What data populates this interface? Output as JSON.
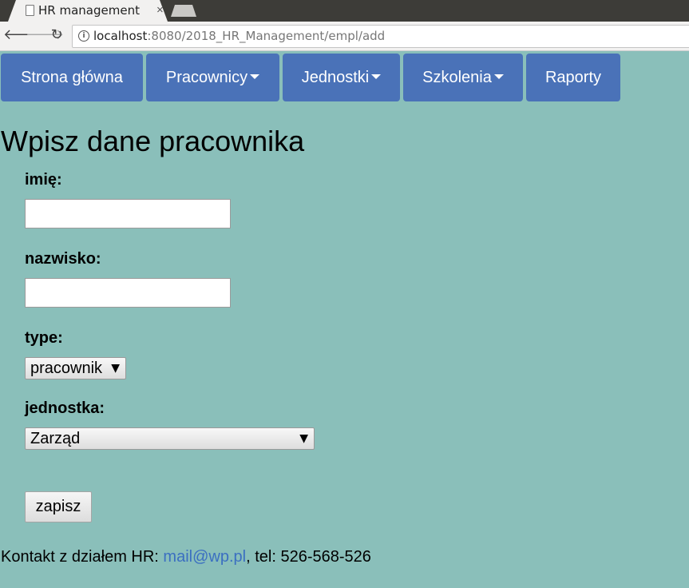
{
  "browser": {
    "tab_title": "HR management",
    "tab_close": "×",
    "url_host": "localhost",
    "url_path": ":8080/2018_HR_Management/empl/add",
    "back_icon": "🡐",
    "forward_icon": "🡒",
    "reload_icon": "↻",
    "info_icon": "i"
  },
  "menu": {
    "items": [
      {
        "label": "Strona główna",
        "dropdown": false
      },
      {
        "label": "Pracownicy",
        "dropdown": true
      },
      {
        "label": "Jednostki",
        "dropdown": true
      },
      {
        "label": "Szkolenia",
        "dropdown": true
      },
      {
        "label": "Raporty",
        "dropdown": false
      }
    ]
  },
  "form": {
    "title": "Wpisz dane pracownika",
    "first_name_label": "imię:",
    "first_name_value": "",
    "last_name_label": "nazwisko:",
    "last_name_value": "",
    "type_label": "type:",
    "type_value": "pracownik",
    "unit_label": "jednostka:",
    "unit_value": "Zarząd",
    "select_arrow": "▼",
    "submit_label": "zapisz"
  },
  "footer": {
    "prefix": "Kontakt z działem HR: ",
    "email": "mail@wp.pl",
    "suffix": ", tel: 526-568-526"
  },
  "colors": {
    "page_background": "#8abfba",
    "menu_button": "#4a72b8",
    "link": "#3b6fc1"
  }
}
